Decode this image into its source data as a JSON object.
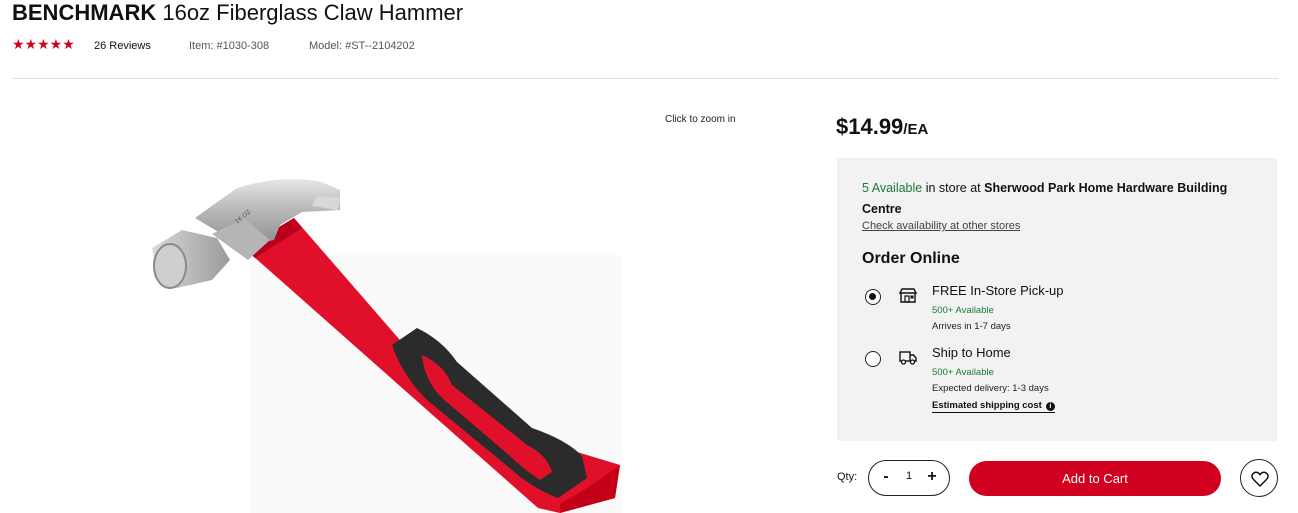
{
  "product": {
    "brand": "BENCHMARK",
    "name": "16oz Fiberglass Claw Hammer",
    "rating": {
      "stars": "★★★★★",
      "value": 5,
      "reviews": "26 Reviews"
    },
    "item_number": "Item: #1030-308",
    "model_number": "Model: #ST--2104202"
  },
  "gallery": {
    "zoom_hint": "Click to zoom in",
    "image_icon": "hammer-product-image"
  },
  "pricing": {
    "amount": "$14.99",
    "unit": "/EA"
  },
  "availability": {
    "count": "5 Available",
    "middle_text": "in store at",
    "store_name": "Sherwood Park Home Hardware Building Centre",
    "check_link": "Check availability at other stores"
  },
  "order": {
    "heading": "Order Online",
    "options": [
      {
        "label": "FREE In-Store Pick-up",
        "available": "500+ Available",
        "delivery": "Arrives in 1-7 days",
        "selected": true,
        "icon": "store-icon"
      },
      {
        "label": "Ship to Home",
        "available": "500+ Available",
        "delivery": "Expected delivery: 1-3 days",
        "shipping_cost_link": "Estimated shipping cost",
        "selected": false,
        "icon": "truck-icon"
      }
    ]
  },
  "cart": {
    "qty_label": "Qty:",
    "qty_value": "1",
    "minus": "-",
    "plus": "+",
    "add_label": "Add to Cart",
    "wishlist_icon": "heart-icon"
  },
  "colors": {
    "accent": "#d2001f",
    "available": "#1b7a3a",
    "panel_bg": "#f2f2f2",
    "star": "#d0021b"
  }
}
